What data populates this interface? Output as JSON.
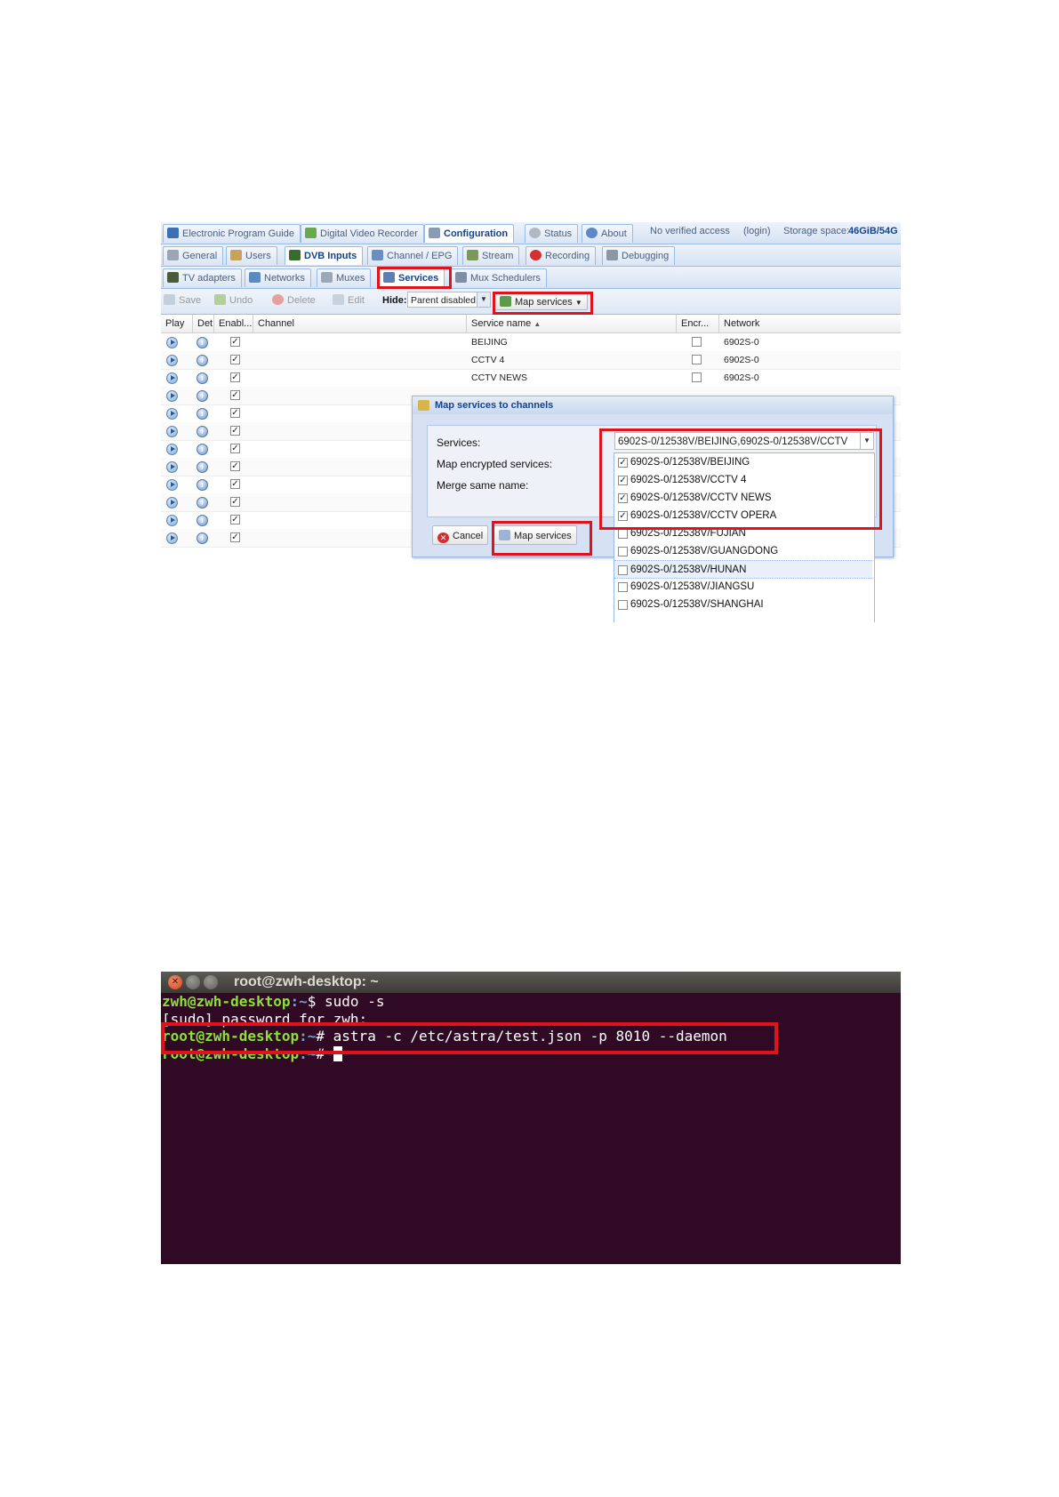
{
  "tvh": {
    "top_tabs": [
      "Electronic Program Guide",
      "Digital Video Recorder",
      "Configuration",
      "Status",
      "About"
    ],
    "access_text": "No verified access",
    "login_text": "(login)",
    "storage_label": "Storage space:",
    "storage_value": "46GiB/54G",
    "config_tabs": [
      "General",
      "Users",
      "DVB Inputs",
      "Channel / EPG",
      "Stream",
      "Recording",
      "Debugging"
    ],
    "dvb_tabs": [
      "TV adapters",
      "Networks",
      "Muxes",
      "Services",
      "Mux Schedulers"
    ],
    "toolbar": {
      "save": "Save",
      "undo": "Undo",
      "delete": "Delete",
      "edit": "Edit",
      "hide_label": "Hide:",
      "hide_value": "Parent disabled",
      "map_services": "Map services"
    },
    "columns": [
      "Play",
      "Det",
      "Enabl...",
      "Channel",
      "Service name",
      "Encr...",
      "Network"
    ],
    "rows": [
      {
        "service": "BEIJING",
        "network": "6902S-0"
      },
      {
        "service": "CCTV 4",
        "network": "6902S-0"
      },
      {
        "service": "CCTV NEWS",
        "network": "6902S-0"
      }
    ],
    "dialog": {
      "title": "Map services to channels",
      "services_label": "Services:",
      "encrypted_label": "Map encrypted services:",
      "merge_label": "Merge same name:",
      "services_value": "6902S-0/12538V/BEIJING,6902S-0/12538V/CCTV",
      "cancel": "Cancel",
      "map_services": "Map services"
    },
    "dropdown_options": [
      {
        "label": "6902S-0/12538V/BEIJING",
        "checked": true
      },
      {
        "label": "6902S-0/12538V/CCTV 4",
        "checked": true
      },
      {
        "label": "6902S-0/12538V/CCTV NEWS",
        "checked": true
      },
      {
        "label": "6902S-0/12538V/CCTV OPERA",
        "checked": true
      },
      {
        "label": "6902S-0/12538V/FUJIAN",
        "checked": false
      },
      {
        "label": "6902S-0/12538V/GUANGDONG",
        "checked": false
      },
      {
        "label": "6902S-0/12538V/HUNAN",
        "checked": false
      },
      {
        "label": "6902S-0/12538V/JIANGSU",
        "checked": false
      },
      {
        "label": "6902S-0/12538V/SHANGHAI",
        "checked": false
      }
    ]
  },
  "terminal": {
    "title": "root@zwh-desktop: ~",
    "line1_prompt_user": "zwh@zwh-desktop",
    "line1_prompt_path": ":~",
    "line1_cmd": "$ sudo -s",
    "line2": "[sudo] password for zwh:",
    "line3_prompt_user": "root@zwh-desktop",
    "line3_prompt_path": ":~",
    "line3_cmd": "# astra -c /etc/astra/test.json -p 8010 --daemon",
    "line4_prompt_user": "root@zwh-desktop",
    "line4_prompt_path": ":~",
    "line4_cmd": "# "
  },
  "colors": {
    "highlight": "#e0121c",
    "terminal_bg": "#300a24",
    "prompt_green": "#8ae234",
    "prompt_blue": "#729fcf"
  }
}
